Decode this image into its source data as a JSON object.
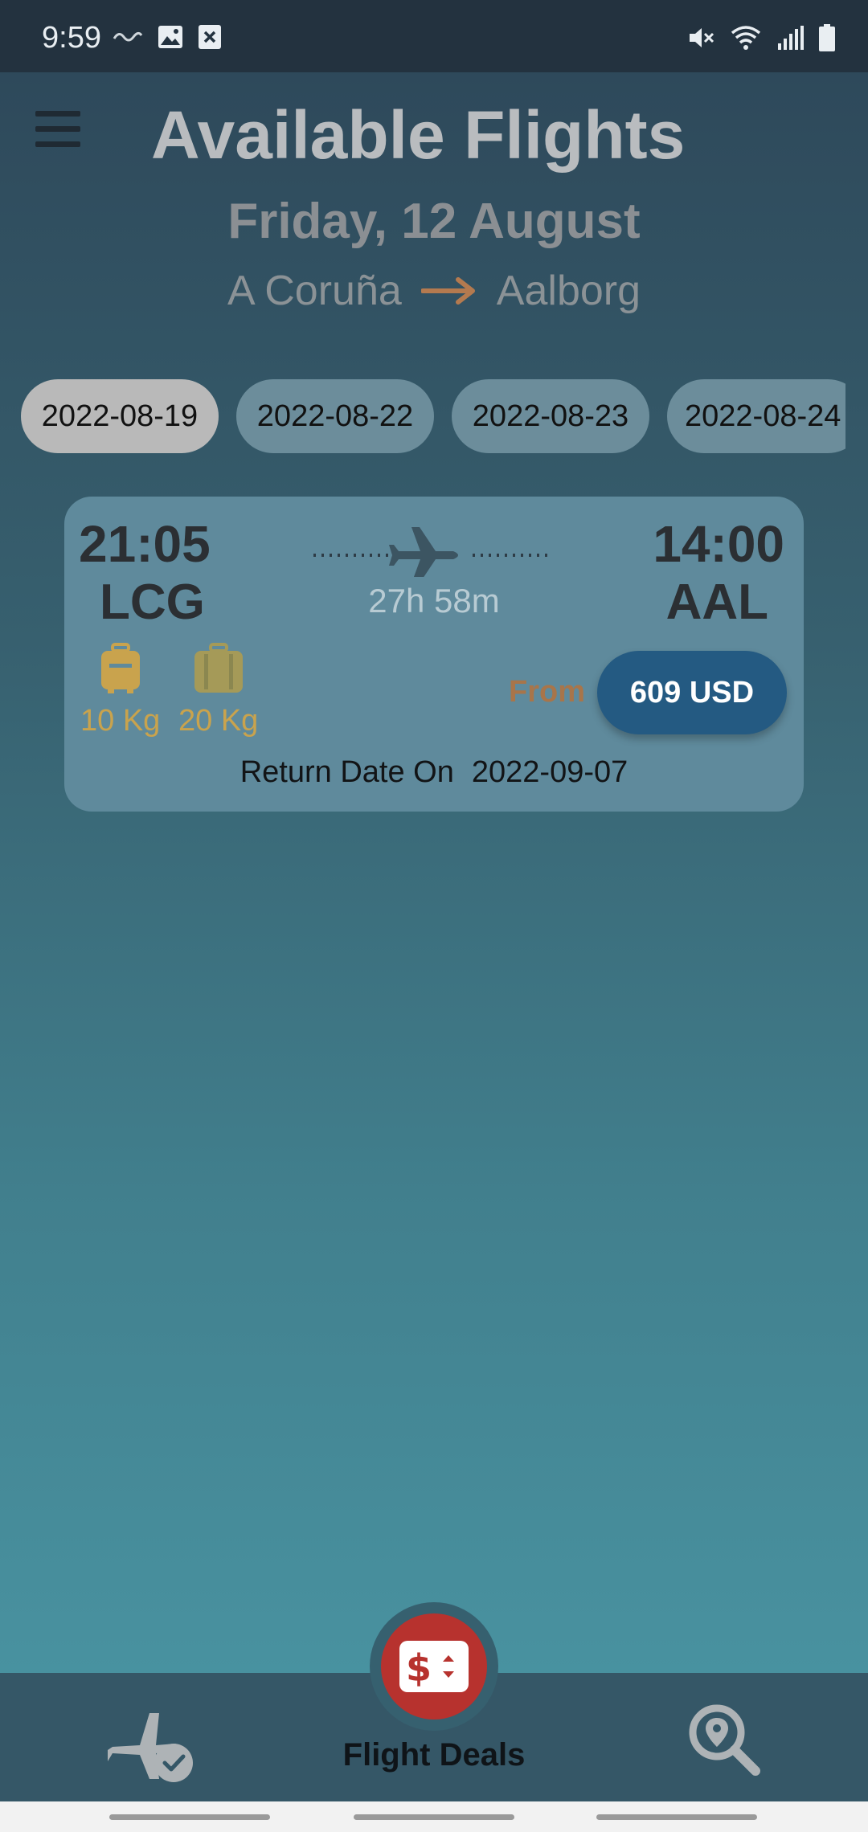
{
  "status_bar": {
    "time": "9:59"
  },
  "header": {
    "title": "Available Flights",
    "date": "Friday, 12 August",
    "origin": "A Coruña",
    "destination": "Aalborg"
  },
  "date_chips": [
    "2022-08-19",
    "2022-08-22",
    "2022-08-23",
    "2022-08-24"
  ],
  "selected_date": "2022-08-19",
  "flight_card": {
    "departure_time": "21:05",
    "departure_code": "LCG",
    "arrival_time": "14:00",
    "arrival_code": "AAL",
    "duration": "27h 58m",
    "cabin_baggage": "10 Kg",
    "checked_baggage": "20 Kg",
    "from_label": "From",
    "price": "609 USD",
    "return_label": "Return Date On",
    "return_date": "2022-09-07"
  },
  "bottom_nav": {
    "center_label": "Flight Deals"
  },
  "colors": {
    "accent_red": "#b7322e",
    "price_button": "#245a82",
    "baggage": "#c9a34d",
    "route_arrow": "#b47a4f"
  }
}
